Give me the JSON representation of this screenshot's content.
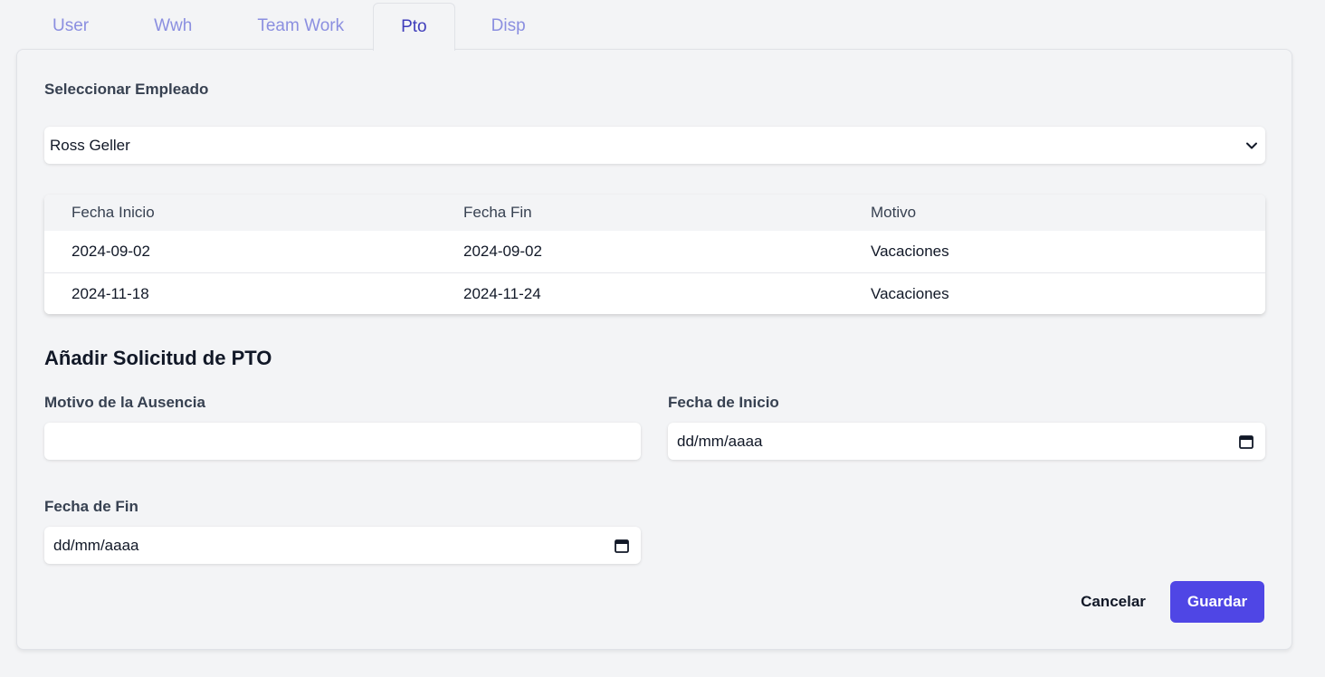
{
  "tabs": [
    {
      "label": "User",
      "active": false
    },
    {
      "label": "Wwh",
      "active": false
    },
    {
      "label": "Team Work",
      "active": false
    },
    {
      "label": "Pto",
      "active": true
    },
    {
      "label": "Disp",
      "active": false
    }
  ],
  "employee": {
    "label": "Seleccionar Empleado",
    "selected": "Ross Geller"
  },
  "pto_table": {
    "headers": [
      "Fecha Inicio",
      "Fecha Fin",
      "Motivo"
    ],
    "rows": [
      [
        "2024-09-02",
        "2024-09-02",
        "Vacaciones"
      ],
      [
        "2024-11-18",
        "2024-11-24",
        "Vacaciones"
      ]
    ]
  },
  "form": {
    "title": "Añadir Solicitud de PTO",
    "reason_label": "Motivo de la Ausencia",
    "reason_value": "",
    "start_label": "Fecha de Inicio",
    "start_placeholder": "dd/mm/aaaa",
    "end_label": "Fecha de Fin",
    "end_placeholder": "dd/mm/aaaa",
    "cancel_label": "Cancelar",
    "save_label": "Guardar"
  },
  "colors": {
    "accent": "#4f46e5",
    "tab_inactive": "#8b8fe0",
    "tab_active": "#3f3dbb"
  },
  "icons": {
    "select": "chevron-down-icon",
    "date": "calendar-icon"
  }
}
